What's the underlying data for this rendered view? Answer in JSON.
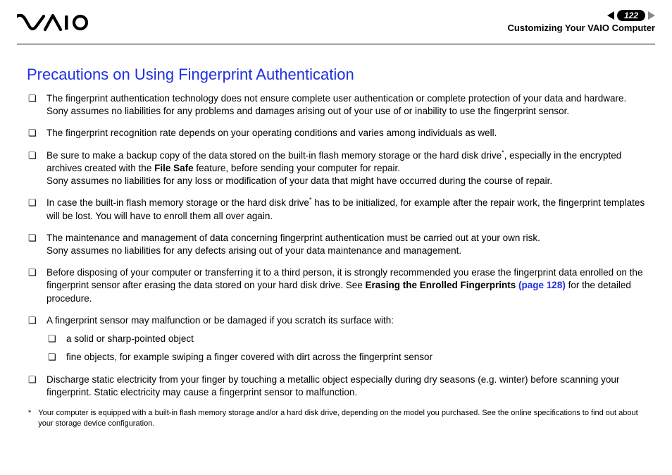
{
  "header": {
    "page_number": "122",
    "section": "Customizing Your VAIO Computer"
  },
  "title": "Precautions on Using Fingerprint Authentication",
  "items": {
    "i1a": "The fingerprint authentication technology does not ensure complete user authentication or complete protection of your data and hardware.",
    "i1b": "Sony assumes no liabilities for any problems and damages arising out of your use of or inability to use the fingerprint sensor.",
    "i2": "The fingerprint recognition rate depends on your operating conditions and varies among individuals as well.",
    "i3a": "Be sure to make a backup copy of the data stored on the built-in flash memory storage or the hard disk drive",
    "i3b": ", especially in the encrypted archives created with the ",
    "i3_bold": "File Safe",
    "i3c": " feature, before sending your computer for repair.",
    "i3d": "Sony assumes no liabilities for any loss or modification of your data that might have occurred during the course of repair.",
    "i4a": "In case the built-in flash memory storage or the hard disk drive",
    "i4b": " has to be initialized, for example after the repair work, the fingerprint templates will be lost. You will have to enroll them all over again.",
    "i5a": "The maintenance and management of data concerning fingerprint authentication must be carried out at your own risk.",
    "i5b": "Sony assumes no liabilities for any defects arising out of your data maintenance and management.",
    "i6a": "Before disposing of your computer or transferring it to a third person, it is strongly recommended you erase the fingerprint data enrolled on the fingerprint sensor after erasing the data stored on your hard disk drive. See ",
    "i6_bold": "Erasing the Enrolled Fingerprints ",
    "i6_link": "(page 128)",
    "i6b": " for the detailed procedure.",
    "i7": "A fingerprint sensor may malfunction or be damaged if you scratch its surface with:",
    "i7s1": "a solid or sharp-pointed object",
    "i7s2": "fine objects, for example swiping a finger covered with dirt across the fingerprint sensor",
    "i8": "Discharge static electricity from your finger by touching a metallic object especially during dry seasons (e.g. winter) before scanning your fingerprint. Static electricity may cause a fingerprint sensor to malfunction."
  },
  "footnote": {
    "mark": "*",
    "text": "Your computer is equipped with a built-in flash memory storage and/or a hard disk drive, depending on the model you purchased. See the online specifications to find out about your storage device configuration."
  }
}
